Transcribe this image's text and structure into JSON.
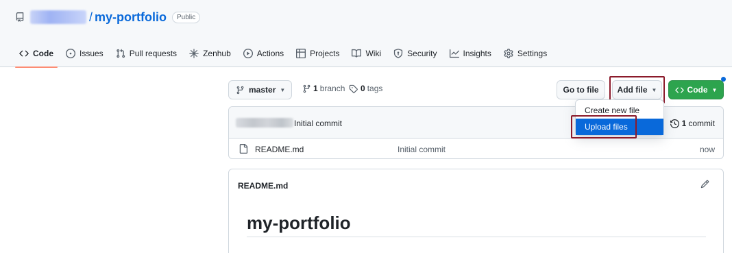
{
  "repo": {
    "separator": "/",
    "name": "my-portfolio",
    "visibility": "Public"
  },
  "tabs": [
    {
      "label": "Code",
      "icon": "code-icon",
      "active": true
    },
    {
      "label": "Issues",
      "icon": "issue-icon"
    },
    {
      "label": "Pull requests",
      "icon": "pull-request-icon"
    },
    {
      "label": "Zenhub",
      "icon": "zenhub-icon"
    },
    {
      "label": "Actions",
      "icon": "play-icon"
    },
    {
      "label": "Projects",
      "icon": "table-icon"
    },
    {
      "label": "Wiki",
      "icon": "book-icon"
    },
    {
      "label": "Security",
      "icon": "shield-icon"
    },
    {
      "label": "Insights",
      "icon": "graph-icon"
    },
    {
      "label": "Settings",
      "icon": "gear-icon"
    }
  ],
  "toolbar": {
    "branch": "master",
    "branch_count": "1",
    "branch_word": "branch",
    "tag_count": "0",
    "tag_word": "tags",
    "go_to_file": "Go to file",
    "add_file": "Add file",
    "code": "Code"
  },
  "commit": {
    "message": "Initial commit",
    "count": "1",
    "count_word": "commit"
  },
  "files": [
    {
      "name": "README.md",
      "commit_message": "Initial commit",
      "time": "now"
    }
  ],
  "dropdown": {
    "items": [
      "Create new file",
      "Upload files"
    ],
    "highlighted": "Upload files"
  },
  "readme": {
    "title": "README.md",
    "heading": "my-portfolio"
  },
  "colors": {
    "accent": "#0969da",
    "primary_button": "#2da44e",
    "annotation_outline": "#8b1a2b",
    "active_tab_underline": "#fd8c73"
  }
}
